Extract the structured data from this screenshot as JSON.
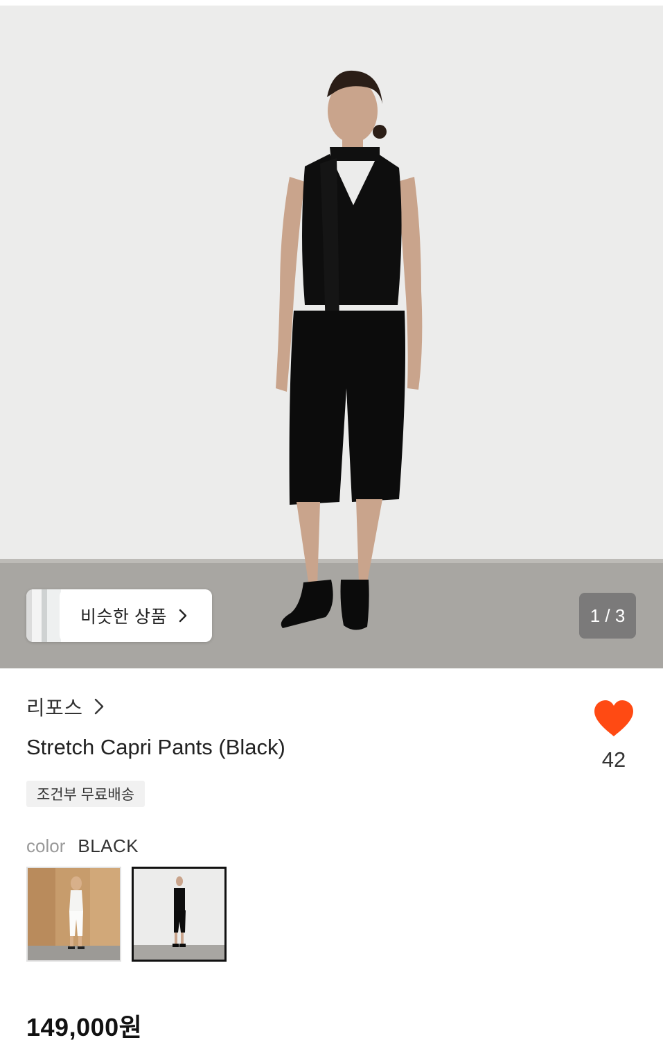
{
  "gallery": {
    "similar_products_label": "비슷한 상품",
    "counter": "1 / 3"
  },
  "product": {
    "brand": "리포스",
    "title": "Stretch Capri Pants (Black)",
    "shipping_badge": "조건부 무료배송",
    "like_count": "42",
    "like_color": "#ff4a13",
    "color_label": "color",
    "color_value": "BLACK",
    "price": "149,000원"
  }
}
